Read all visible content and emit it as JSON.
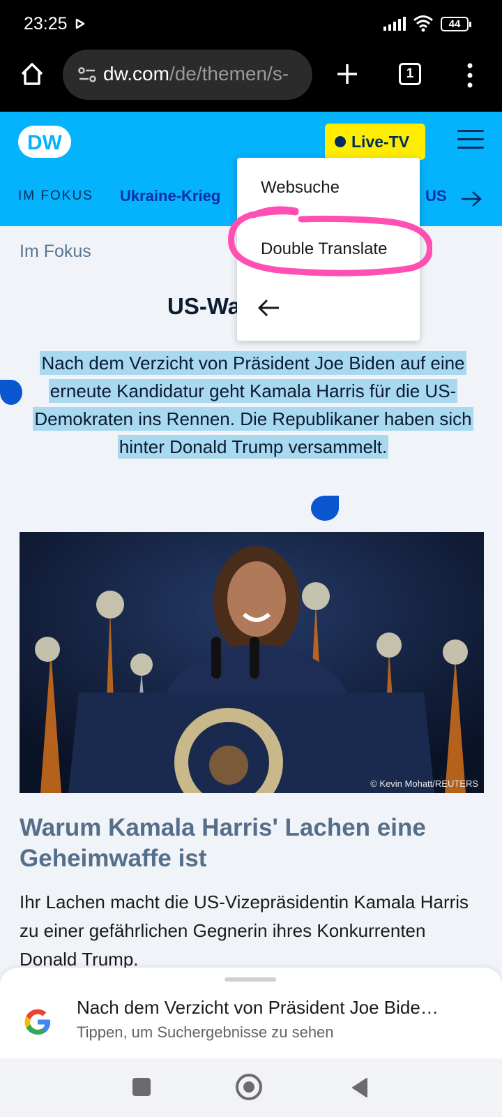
{
  "status_bar": {
    "time": "23:25",
    "battery": "44",
    "icons": [
      "play-icon",
      "signal-icon",
      "wifi-icon",
      "battery-icon"
    ]
  },
  "browser": {
    "url_host": "dw.com",
    "url_path": "/de/themen/s-",
    "tab_count": "1"
  },
  "site_header": {
    "logo": "DW",
    "live_tv": "Live-TV",
    "nav": {
      "fokus": "IM FOKUS",
      "ukraine": "Ukraine-Krieg",
      "us": "US"
    }
  },
  "content": {
    "kicker": "Im Fokus",
    "section_title": "US-Wa",
    "selected_text": "Nach dem Verzicht von Präsident Joe Biden auf eine erneute Kandidatur geht Kamala Harris für die US-Demokraten ins Rennen. Die Republikaner haben sich hinter Donald Trump versammelt.",
    "photo_credit": "© Kevin Mohatt/REUTERS",
    "headline": "Warum Kamala Harris' Lachen eine Geheimwaffe ist",
    "teaser": "Ihr Lachen macht die US-Vizepräsidentin Kamala Harris zu einer gefährlichen Gegnerin ihres Konkurrenten Donald Trump."
  },
  "context_menu": {
    "items": [
      "Websuche",
      "Double Translate"
    ]
  },
  "bottom_sheet": {
    "title": "Nach dem Verzicht von Präsident Joe Bide…",
    "subtitle": "Tippen, um Suchergebnisse zu sehen"
  },
  "colors": {
    "dw_blue": "#05b2fc",
    "live_yellow": "#ffed00",
    "selection": "#a8d9ef",
    "scribble": "#ff4fb3",
    "handle": "#0b57d0"
  }
}
